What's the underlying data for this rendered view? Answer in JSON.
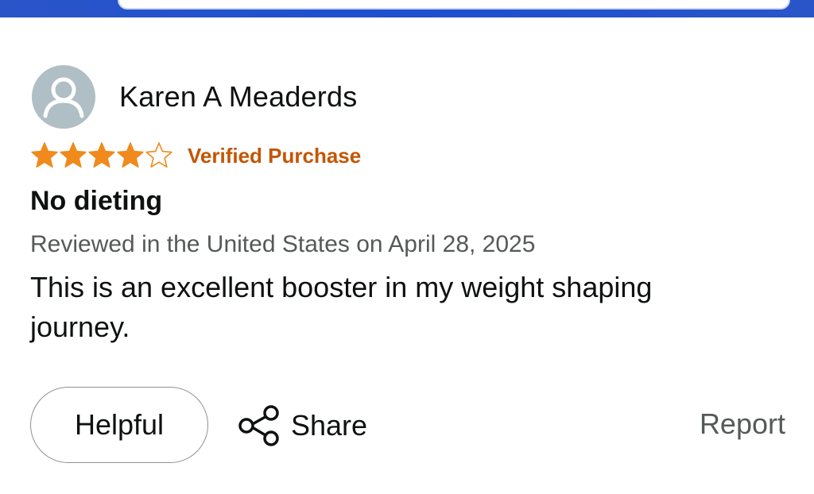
{
  "colors": {
    "header_blue": "#2a55c9",
    "star_orange": "#f08a1c",
    "verified_orange": "#c45500",
    "avatar_gray": "#b0bec5",
    "meta_gray": "#565959"
  },
  "review": {
    "reviewer_name": "Karen A Meaderds",
    "avatar_icon": "user-silhouette-icon",
    "rating": 4,
    "rating_max": 5,
    "verified_label": "Verified Purchase",
    "title": "No dieting",
    "meta": "Reviewed in the United States on April 28, 2025",
    "body": "This is an excellent booster in my weight shaping journey."
  },
  "actions": {
    "helpful_label": "Helpful",
    "share_label": "Share",
    "share_icon": "share-icon",
    "report_label": "Report"
  }
}
